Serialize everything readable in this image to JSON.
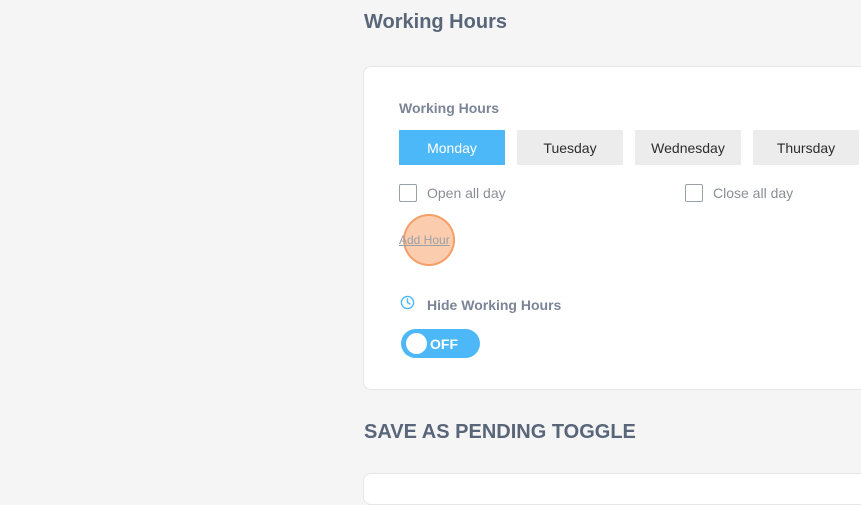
{
  "section_working_hours": {
    "title": "Working Hours"
  },
  "card": {
    "field_label": "Working Hours",
    "days": [
      {
        "label": "Monday",
        "active": true
      },
      {
        "label": "Tuesday",
        "active": false
      },
      {
        "label": "Wednesday",
        "active": false
      },
      {
        "label": "Thursday",
        "active": false
      }
    ],
    "open_all_day": {
      "label": "Open all day",
      "checked": false
    },
    "close_all_day": {
      "label": "Close all day",
      "checked": false
    },
    "add_hour_label": "Add Hour",
    "hide_working_hours": {
      "label": "Hide Working Hours",
      "icon": "clock-icon"
    },
    "toggle": {
      "label": "OFF",
      "state": false
    }
  },
  "section_save_pending": {
    "title": "SAVE AS PENDING TOGGLE"
  },
  "colors": {
    "accent": "#4db8f8",
    "heading": "#59667a",
    "click_marker": "#faaa78"
  }
}
